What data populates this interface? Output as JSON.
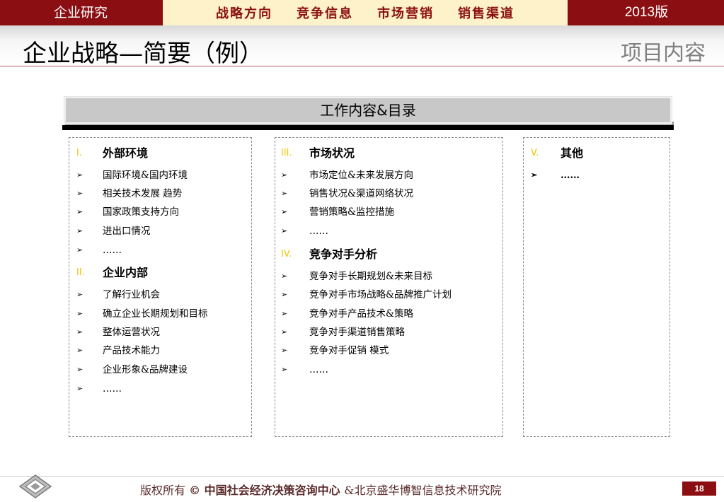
{
  "top_nav": {
    "left": "企业研究",
    "tabs": [
      "战略方向",
      "竞争信息",
      "市场营销",
      "销售渠道"
    ],
    "right": "2013版"
  },
  "page": {
    "title": "企业战略—简要（例）",
    "section": "项目内容"
  },
  "panel": {
    "header": "工作内容&目录",
    "columns": [
      {
        "sections": [
          {
            "num": "I.",
            "title": "外部环境",
            "items": [
              "国际环境&国内环境",
              "相关技术发展 趋势",
              "国家政策支持方向",
              "进出口情况",
              "……"
            ]
          },
          {
            "num": "II.",
            "title": "企业内部",
            "items": [
              "了解行业机会",
              "确立企业长期规划和目标",
              "整体运营状况",
              "产品技术能力",
              "企业形象&品牌建设",
              "……"
            ]
          }
        ]
      },
      {
        "sections": [
          {
            "num": "III.",
            "title": "市场状况",
            "items": [
              "市场定位&未来发展方向",
              "销售状况&渠道网络状况",
              "营销策略&监控措施",
              "……"
            ]
          },
          {
            "num": "IV.",
            "title": "竞争对手分析",
            "items": [
              "竞争对手长期规划&未来目标",
              "竞争对手市场战略&品牌推广计划",
              "竞争对手产品技术&策略",
              "竞争对手渠道销售策略",
              "竞争对手促销 模式",
              "……"
            ]
          }
        ]
      },
      {
        "sections": [
          {
            "num": "V.",
            "title": "其他",
            "items": [
              "……"
            ]
          }
        ]
      }
    ]
  },
  "footer": {
    "prefix": "版权所有 ",
    "symbol": "©",
    "org1": " 中国社会经济决策咨询中心 ",
    "org2": "&北京盛华博智信息技术研究院",
    "page_number": "18"
  },
  "colors": {
    "brand_red": "#8b0f12",
    "nav_bg": "#fdf2c9",
    "numeral_yellow": "#f2c400"
  },
  "icons": {
    "bullet": "arrowhead-bullet-icon",
    "logo": "diamond-logo-icon"
  }
}
